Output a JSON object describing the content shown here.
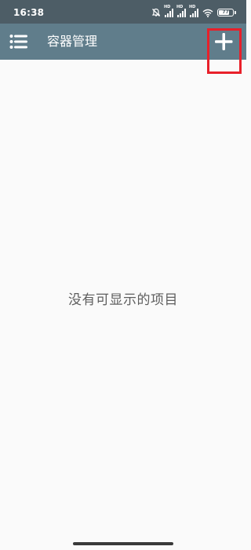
{
  "status_bar": {
    "time": "16:38",
    "battery_level": "77",
    "icons": [
      "alarm-off-icon",
      "hd-signal-icon",
      "hd-signal-icon",
      "hd-signal-icon",
      "wifi-icon",
      "battery-icon"
    ]
  },
  "app_bar": {
    "title": "容器管理",
    "menu_icon": "list-menu-icon",
    "add_icon": "plus-icon",
    "color": "#607d8b"
  },
  "main": {
    "empty_message": "没有可显示的项目"
  },
  "colors": {
    "status_bar": "#4d5d66",
    "app_bar": "#607d8b",
    "background": "#fafafa",
    "highlight": "#e8202a"
  }
}
